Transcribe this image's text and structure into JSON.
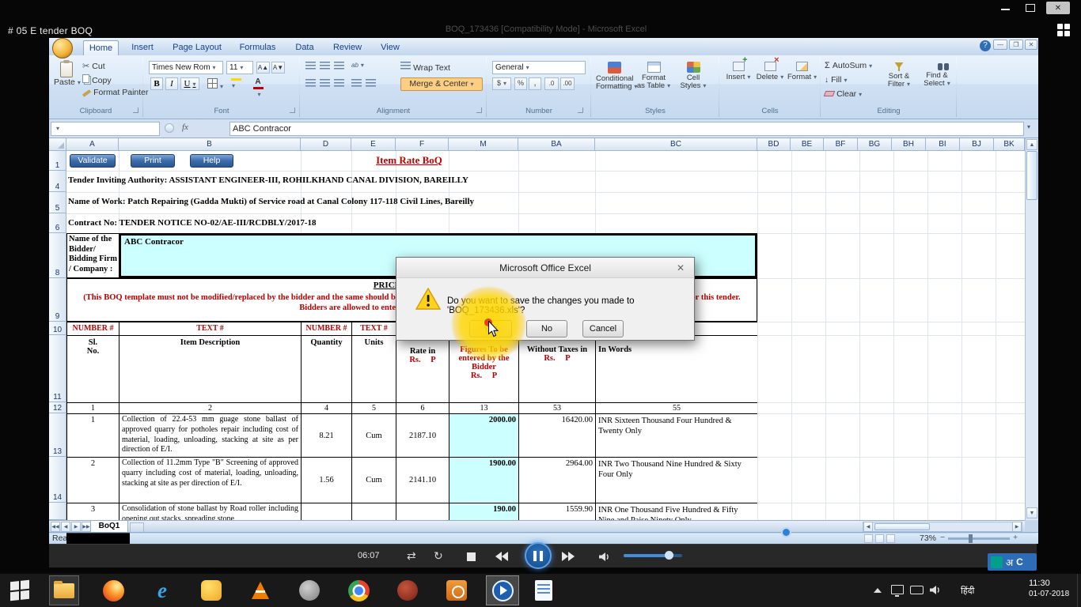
{
  "overlay": {
    "video_title": "# 05  E tender  BOQ",
    "window_title_ghost": "BOQ_173436  [Compatibility Mode] - Microsoft Excel"
  },
  "player": {
    "elapsed": "06:07"
  },
  "excel": {
    "tabs": [
      "Home",
      "Insert",
      "Page Layout",
      "Formulas",
      "Data",
      "Review",
      "View"
    ],
    "ribbon": {
      "clipboard": {
        "label": "Clipboard",
        "paste": "Paste",
        "cut": "Cut",
        "copy": "Copy",
        "format_painter": "Format Painter"
      },
      "font": {
        "label": "Font",
        "family": "Times New Rom",
        "size": "11",
        "bold": "B",
        "italic": "I",
        "underline": "U"
      },
      "alignment": {
        "label": "Alignment",
        "wrap_text": "Wrap Text",
        "merge_center": "Merge & Center"
      },
      "number": {
        "label": "Number",
        "format": "General"
      },
      "styles": {
        "label": "Styles",
        "conditional_1": "Conditional",
        "conditional_2": "Formatting",
        "format_table_1": "Format",
        "format_table_2": "as Table",
        "cell_styles_1": "Cell",
        "cell_styles_2": "Styles"
      },
      "cells": {
        "label": "Cells",
        "insert": "Insert",
        "delete": "Delete",
        "format": "Format"
      },
      "editing": {
        "label": "Editing",
        "autosum": "AutoSum",
        "fill": "Fill",
        "clear": "Clear",
        "sort_1": "Sort &",
        "sort_2": "Filter",
        "find_1": "Find &",
        "find_2": "Select"
      }
    },
    "formula_bar": {
      "fx": "fx",
      "value": "ABC Contracor"
    },
    "columns": [
      "A",
      "B",
      "D",
      "E",
      "F",
      "M",
      "BA",
      "BC",
      "BD",
      "BE",
      "BF",
      "BG",
      "BH",
      "BI",
      "BJ",
      "BK"
    ],
    "row_numbers": [
      "1",
      "4",
      "5",
      "6",
      "8",
      "9",
      "10",
      "11",
      "12",
      "13",
      "14"
    ],
    "sheet": {
      "buttons": [
        "Validate",
        "Print",
        "Help"
      ],
      "title": "Item Rate BoQ",
      "authority": "Tender Inviting Authority: ASSISTANT ENGINEER-III, ROHILKHAND CANAL DIVISION, BAREILLY",
      "work_name": "Name of Work: Patch Repairing (Gadda Mukti) of Service road at Canal Colony 117-118 Civil Lines, Bareilly",
      "contract_no": "Contract No:  TENDER NOTICE NO-02/AE-III/RCDBLY/2017-18",
      "bidder_label": "Name of the Bidder/ Bidding Firm / Company :",
      "bidder_value": "ABC Contracor",
      "price_heading": "PRICE SCHEDULE",
      "template_warning": "(This BOQ template must not be modified/replaced by the bidder and the same should be uploaded after filling the relevant columns, else the bidder is liable to be rejected for this tender. Bidders are allowed to enter the Bidder Name and Values only )",
      "type_row": [
        "NUMBER #",
        "TEXT #",
        "NUMBER #",
        "TEXT #"
      ],
      "header_row": {
        "sl": "Sl. No.",
        "desc": "Item Description",
        "qty": "Quantity",
        "units": "Units",
        "rate_black": "Rate in",
        "rate_red": "Rs. P",
        "figures_red": "Figures To be entered by the Bidder",
        "figures_rs": "Rs. P",
        "without_black": "Without Taxes in",
        "without_red": "Rs. P",
        "words": "In Words"
      },
      "index_row": [
        "1",
        "2",
        "4",
        "5",
        "6",
        "13",
        "53",
        "55"
      ],
      "items": [
        {
          "sl": "1",
          "desc": "Collection of 22.4-53 mm guage stone ballast of approved quarry for potholes repair including cost of material, loading, unloading, stacking at site as per direction of E/I.",
          "qty": "8.21",
          "unit": "Cum",
          "rate": "2187.10",
          "entered": "2000.00",
          "total": "16420.00",
          "words": "INR Sixteen Thousand Four Hundred & Twenty Only"
        },
        {
          "sl": "2",
          "desc": "Collection of 11.2mm Type \"B\" Screening of approved quarry including cost of material, loading, unloading, stacking at site as per direction of E/I.",
          "qty": "1.56",
          "unit": "Cum",
          "rate": "2141.10",
          "entered": "1900.00",
          "total": "2964.00",
          "words": "INR Two Thousand Nine Hundred & Sixty Four Only"
        },
        {
          "sl": "3",
          "desc": "Consolidation of stone ballast by Road roller including opening out stacks, spreading stone",
          "qty": "",
          "unit": "",
          "rate": "",
          "entered": "190.00",
          "total": "1559.90",
          "words": "INR One Thousand Five Hundred & Fifty Nine and Paise Ninety Only"
        }
      ],
      "tab_name": "BoQ1"
    },
    "status": {
      "ready": "Rea",
      "zoom": "73%"
    }
  },
  "dialog": {
    "title": "Microsoft Office Excel",
    "message": "Do you want to save the changes you made to 'BOQ_173436.xls'?",
    "yes": "Yes",
    "no": "No",
    "cancel": "Cancel"
  },
  "taskbar": {
    "lang_label": "हिंदी",
    "lang_a": "अ",
    "lang_c": "C",
    "time": "11:30",
    "date": "01-07-2018"
  },
  "colors": {
    "input_cell": "#ccffff",
    "warning_text": "#c00000",
    "highlight_circle": "#ffd800",
    "pause_accent": "#5ea0e8",
    "taskbar_bg": "#191919"
  }
}
